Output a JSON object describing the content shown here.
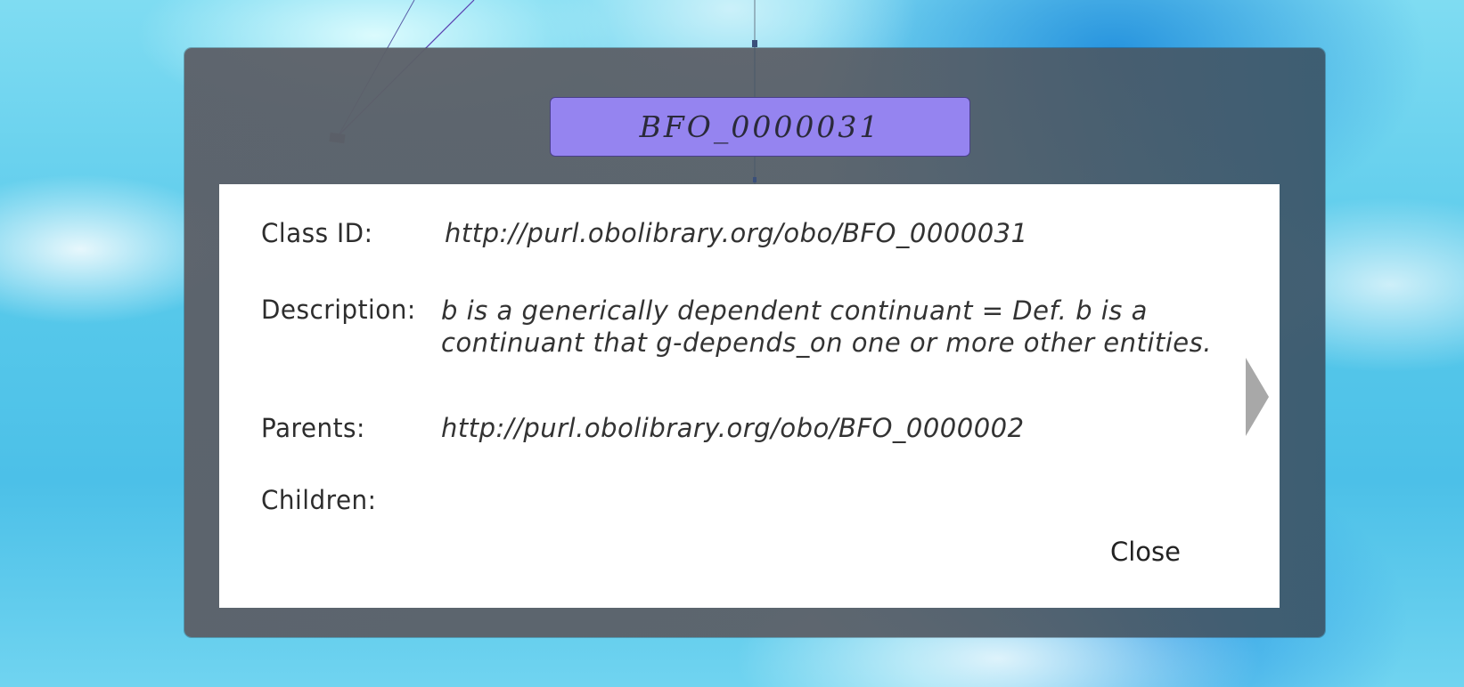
{
  "dialog": {
    "title": "BFO_0000031",
    "fields": {
      "class_id": {
        "label": "Class ID:",
        "value": "http://purl.obolibrary.org/obo/BFO_0000031"
      },
      "description": {
        "label": "Description:",
        "value_line1": "b is a generically dependent continuant = Def. b is a",
        "value_line2": "continuant that g-depends_on one or more other entities."
      },
      "parents": {
        "label": "Parents:",
        "value": "http://purl.obolibrary.org/obo/BFO_0000002"
      },
      "children": {
        "label": "Children:",
        "value": ""
      }
    },
    "close_label": "Close",
    "next_icon": "chevron-right-icon"
  },
  "colors": {
    "title_badge": "#9584f0",
    "frame": "#5c6068",
    "panel": "#ffffff",
    "next_arrow": "#a8a8a8"
  }
}
